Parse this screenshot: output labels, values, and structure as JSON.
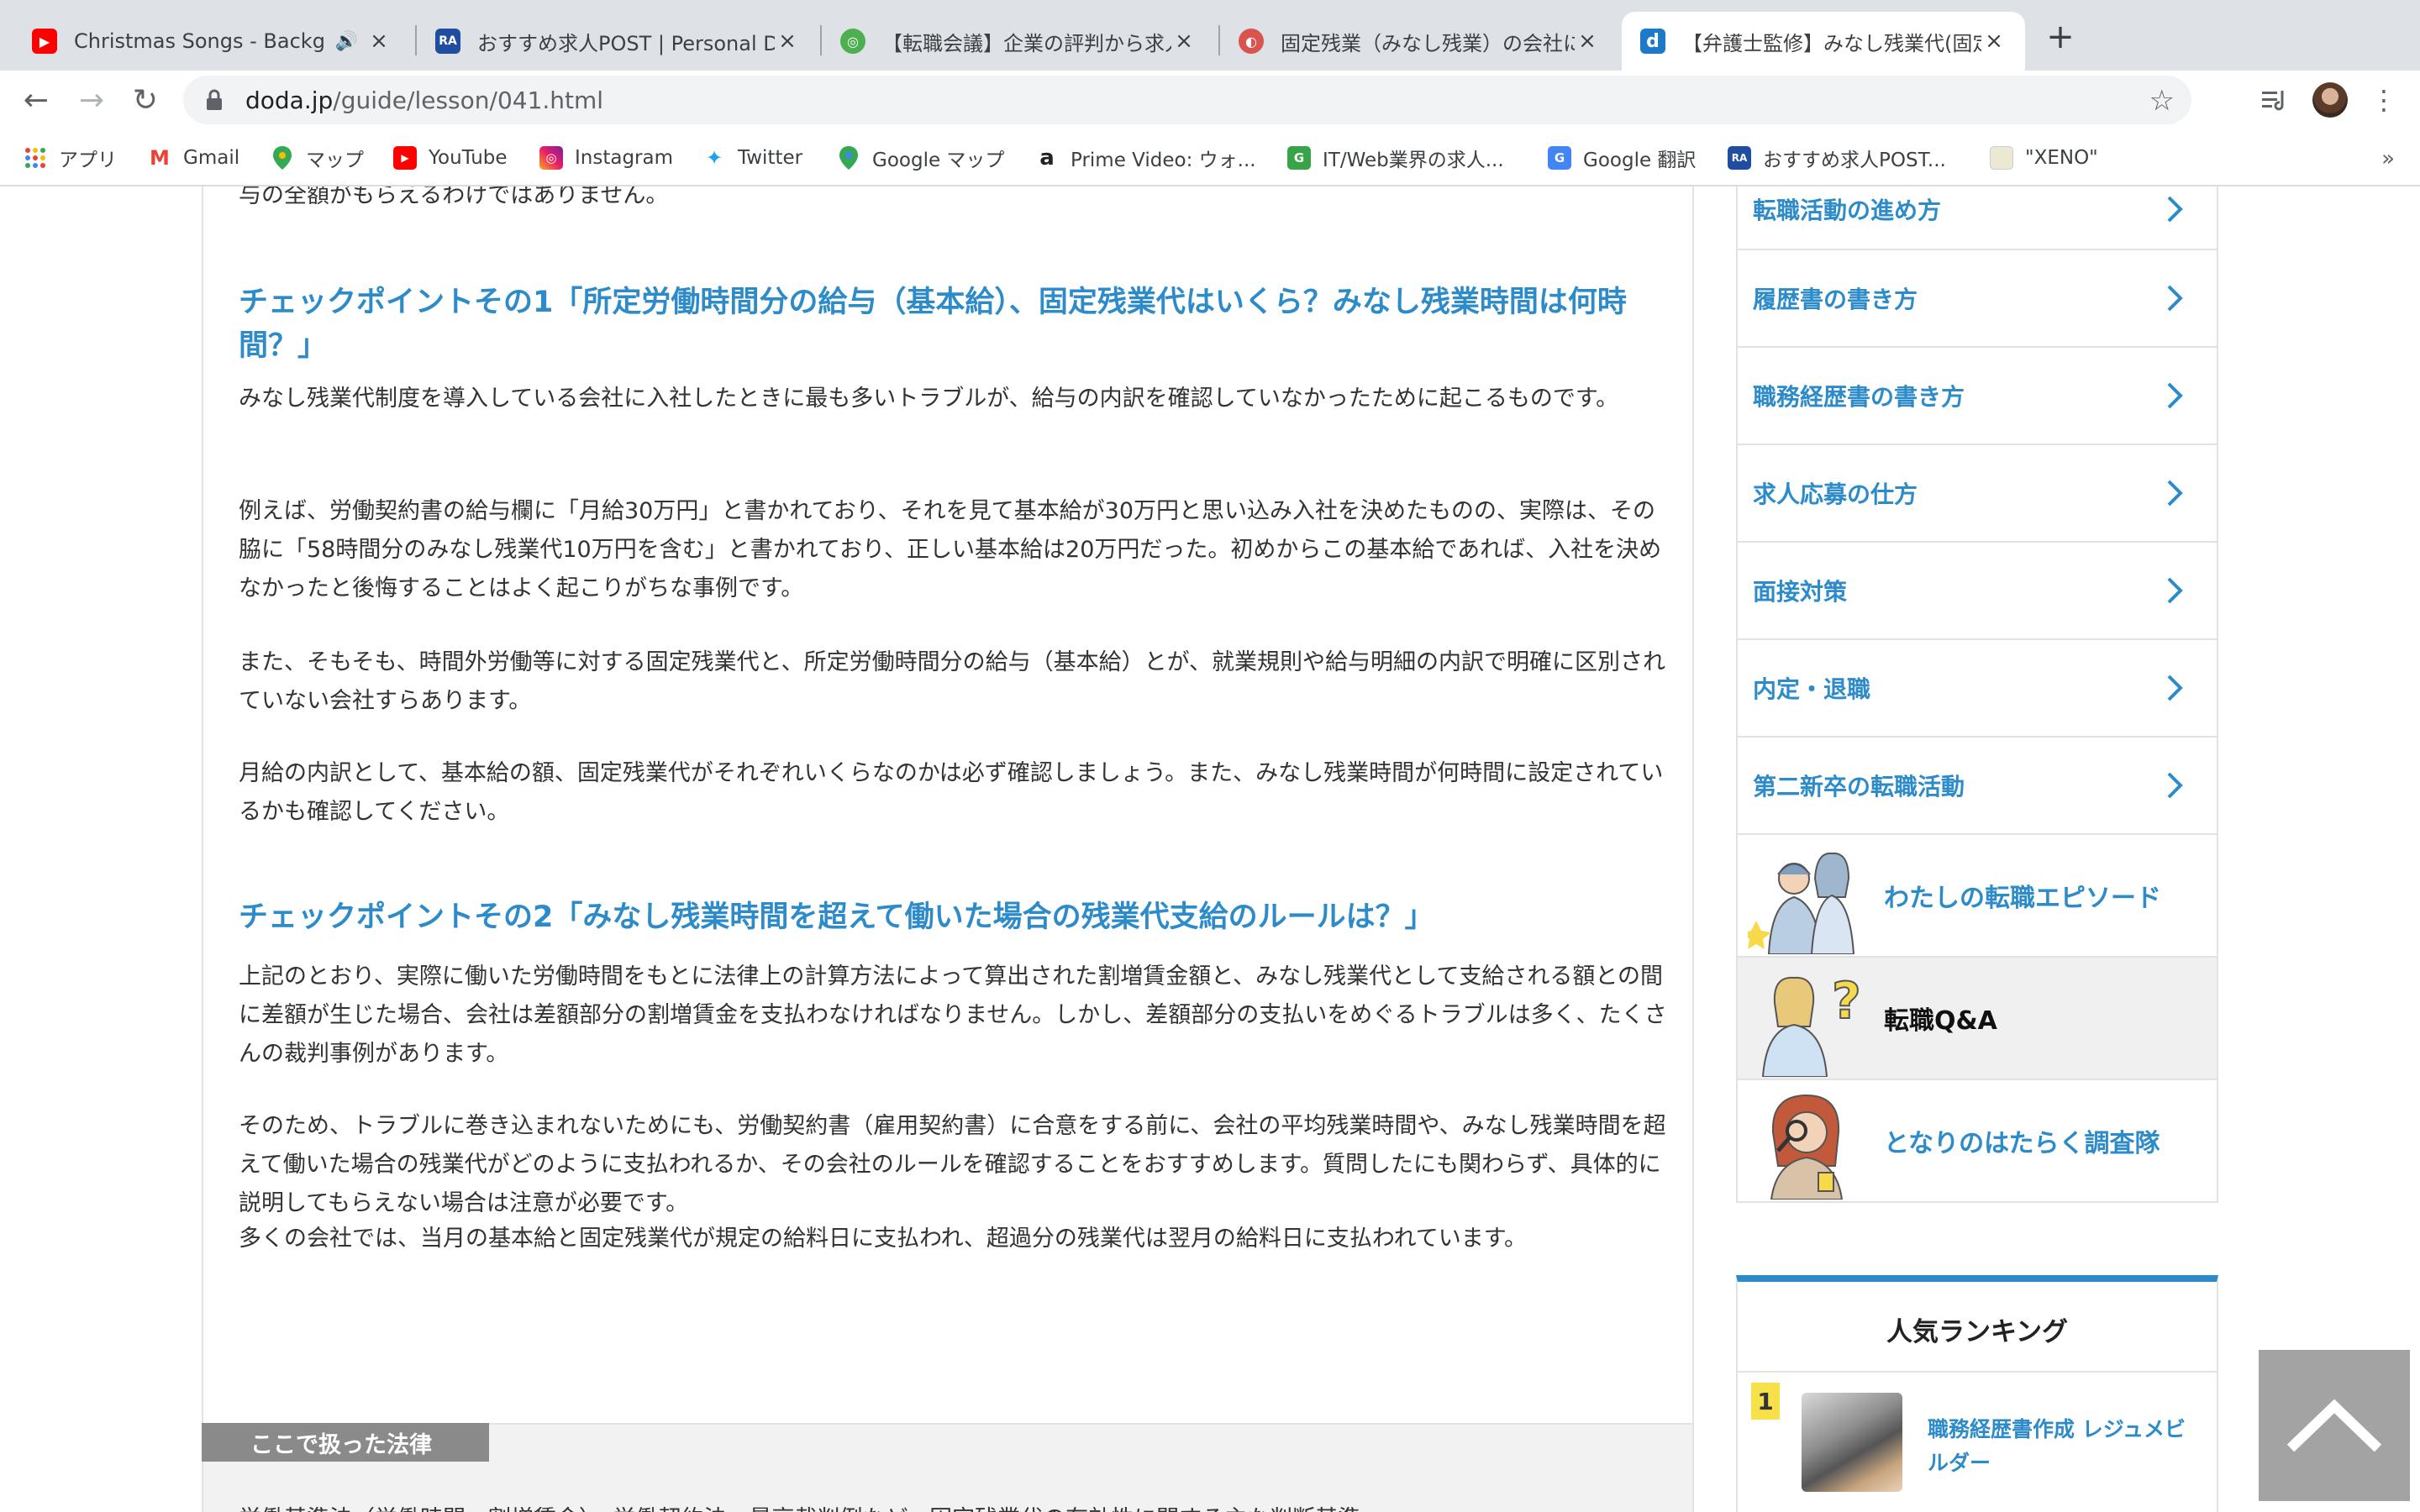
{
  "tabs": [
    {
      "title": "Christmas Songs - Background Music",
      "favicon_text": "▶",
      "favicon_color": "#ff0000",
      "active": false,
      "audio": true
    },
    {
      "title": "おすすめ求人POST | Personal Data",
      "favicon_text": "RA",
      "favicon_color": "#1f4ea1",
      "active": false
    },
    {
      "title": "【転職会議】企業の評判から求人まで",
      "favicon_text": "◎",
      "favicon_color": "#4caf50",
      "active": false
    },
    {
      "title": "固定残業（みなし残業）の会社に転職",
      "favicon_text": "◐",
      "favicon_color": "#d9534f",
      "active": false
    },
    {
      "title": "【弁護士監修】みなし残業代(固定残業代)",
      "favicon_text": "d",
      "favicon_color": "#1d7ac9",
      "active": true
    }
  ],
  "toolbar": {
    "url_host": "doda.jp",
    "url_path": "/guide/lesson/041.html"
  },
  "bookmarks": [
    {
      "label": "アプリ",
      "icon": "apps-grid-icon"
    },
    {
      "label": "Gmail",
      "icon": "gmail-icon",
      "icon_text": "M",
      "color": "#ea4335"
    },
    {
      "label": "マップ",
      "icon": "maps-pin-icon",
      "color": "#34a853"
    },
    {
      "label": "YouTube",
      "icon": "youtube-icon",
      "icon_text": "▶",
      "color": "#ff0000"
    },
    {
      "label": "Instagram",
      "icon": "instagram-icon",
      "icon_text": "◎",
      "color": "#c13584"
    },
    {
      "label": "Twitter",
      "icon": "twitter-icon",
      "icon_text": "✦",
      "color": "#1da1f2"
    },
    {
      "label": "Google マップ",
      "icon": "maps-pin-icon",
      "color": "#34a853"
    },
    {
      "label": "Prime Video: ウォ...",
      "icon": "amazon-icon",
      "icon_text": "a",
      "color": "#222222"
    },
    {
      "label": "IT/Web業界の求人...",
      "icon": "green-icon",
      "icon_text": "G",
      "color": "#37a447"
    },
    {
      "label": "Google 翻訳",
      "icon": "translate-icon",
      "icon_text": "G",
      "color": "#4285f4"
    },
    {
      "label": "おすすめ求人POST...",
      "icon": "ra-icon",
      "icon_text": "RA",
      "color": "#1f4ea1"
    },
    {
      "label": "\"XENO\"",
      "icon": "page-icon",
      "color": "#e8e2c8"
    }
  ],
  "article": {
    "intro_tail": "与の全額がもらえるわけではありません。",
    "heading1": "チェックポイントその1「所定労働時間分の給与（基本給）、固定残業代はいくら？みなし残業時間は何時間？」",
    "p1": "みなし残業代制度を導入している会社に入社したときに最も多いトラブルが、給与の内訳を確認していなかったために起こるものです。",
    "p2": "例えば、労働契約書の給与欄に「月給30万円」と書かれており、それを見て基本給が30万円と思い込み入社を決めたものの、実際は、その脇に「58時間分のみなし残業代10万円を含む」と書かれており、正しい基本給は20万円だった。初めからこの基本給であれば、入社を決めなかったと後悔することはよく起こりがちな事例です。",
    "p3": "また、そもそも、時間外労働等に対する固定残業代と、所定労働時間分の給与（基本給）とが、就業規則や給与明細の内訳で明確に区別されていない会社すらあります。",
    "p4": "月給の内訳として、基本給の額、固定残業代がそれぞれいくらなのかは必ず確認しましょう。また、みなし残業時間が何時間に設定されているかも確認してください。",
    "heading2": "チェックポイントその2「みなし残業時間を超えて働いた場合の残業代支給のルールは？」",
    "p5": "上記のとおり、実際に働いた労働時間をもとに法律上の計算方法によって算出された割増賃金額と、みなし残業代として支給される額との間に差額が生じた場合、会社は差額部分の割増賃金を支払わなければなりません。しかし、差額部分の支払いをめぐるトラブルは多く、たくさんの裁判事例があります。",
    "p6": "そのため、トラブルに巻き込まれないためにも、労働契約書（雇用契約書）に合意をする前に、会社の平均残業時間や、みなし残業時間を超えて働いた場合の残業代がどのように支払われるか、その会社のルールを確認することをおすすめします。質問したにも関わらず、具体的に説明してもらえない場合は注意が必要です。",
    "p7": "多くの会社では、当月の基本給と固定残業代が規定の給料日に支払われ、超過分の残業代は翌月の給料日に支払われています。"
  },
  "law_box": {
    "label": "ここで扱った法律",
    "text": "労働基準法（労働時間・割増賃金）、労働契約法、最高裁判例など、固定残業代の有効性に関する主な判断基準"
  },
  "sidebar": {
    "items": [
      {
        "label": "転職活動の進め方"
      },
      {
        "label": "履歴書の書き方"
      },
      {
        "label": "職務経歴書の書き方"
      },
      {
        "label": "求人応募の仕方"
      },
      {
        "label": "面接対策"
      },
      {
        "label": "内定・退職"
      },
      {
        "label": "第二新卒の転職活動"
      }
    ],
    "image_items": [
      {
        "label": "わたしの転職エピソード",
        "highlighted": false
      },
      {
        "label": "転職Q&A",
        "highlighted": true
      },
      {
        "label": "となりのはたらく調査隊",
        "highlighted": false
      }
    ]
  },
  "ranking": {
    "title": "人気ランキング",
    "items": [
      {
        "rank": "1",
        "label": "職務経歴書作成 レジュメビルダー"
      }
    ]
  },
  "colors": {
    "accent": "#2d8bc9",
    "rank_badge": "#f7e14a",
    "scroll_button": "#a3a3a3"
  }
}
